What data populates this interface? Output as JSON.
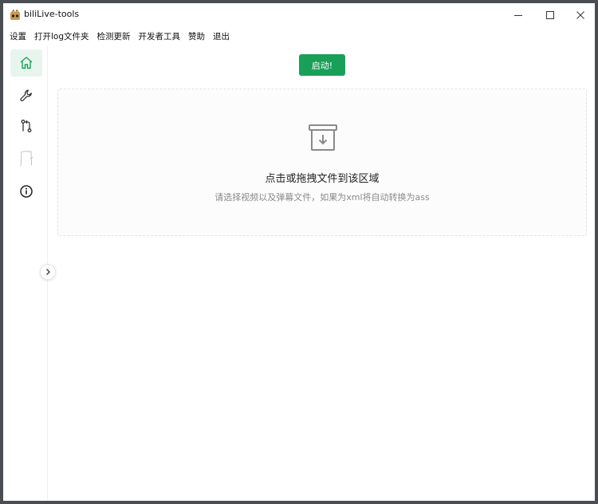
{
  "window": {
    "title": "biliLive-tools"
  },
  "menu": {
    "items": [
      "设置",
      "打开log文件夹",
      "检测更新",
      "开发者工具",
      "赞助",
      "退出"
    ]
  },
  "sidebar": {
    "items": [
      {
        "icon": "home-icon",
        "active": true
      },
      {
        "icon": "wrench-icon",
        "active": false
      },
      {
        "icon": "git-compare-icon",
        "active": false
      },
      {
        "icon": "sketch-figure-icon",
        "active": false
      },
      {
        "icon": "info-icon",
        "active": false
      }
    ]
  },
  "main": {
    "start_label": "启动!",
    "drop_title": "点击或拖拽文件到该区域",
    "drop_subtitle": "请选择视频以及弹幕文件，如果为xml将自动转换为ass"
  },
  "colors": {
    "accent": "#18a058",
    "frame": "#4a4d52"
  }
}
